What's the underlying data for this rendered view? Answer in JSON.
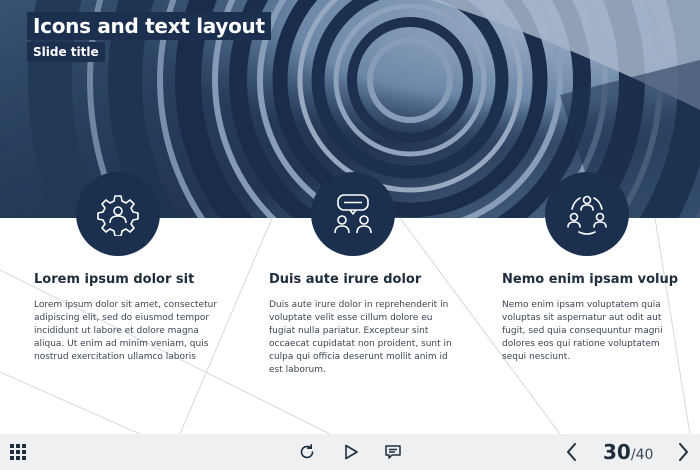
{
  "slide": {
    "title": "Icons and text layout",
    "subtitle": "Slide title"
  },
  "columns": [
    {
      "icon": "gear-user-icon",
      "heading": "Lorem ipsum dolor sit",
      "body": "Lorem ipsum dolor sit amet, consectetur adipiscing elit, sed do eiusmod tempor incididunt ut labore et dolore magna aliqua. Ut enim ad minim veniam, quis nostrud exercitation ullamco laboris"
    },
    {
      "icon": "chat-users-icon",
      "heading": "Duis aute irure dolor",
      "body": "Duis aute irure dolor in reprehenderit in voluptate velit esse cillum dolore eu fugiat nulla pariatur. Excepteur sint occaecat cupidatat non proident, sunt in culpa qui officia deserunt mollit anim id est laborum."
    },
    {
      "icon": "team-cycle-icon",
      "heading": "Nemo enim ipsam volup",
      "body": "Nemo enim ipsam voluptatem quia voluptas sit aspernatur aut odit aut fugit, sed quia consequuntur magni dolores eos qui ratione voluptatem sequi nesciunt."
    }
  ],
  "toolbar": {
    "menu_icon": "grid-menu-icon",
    "replay_icon": "replay-icon",
    "play_icon": "play-icon",
    "notes_icon": "notes-icon",
    "prev_icon": "chevron-left-icon",
    "next_icon": "chevron-right-icon",
    "current_page": "30",
    "separator": "/",
    "total_pages": "40"
  },
  "colors": {
    "accent_dark": "#1b2f4f",
    "toolbar_bg": "#eef0f2",
    "text": "#1f2d3d"
  }
}
